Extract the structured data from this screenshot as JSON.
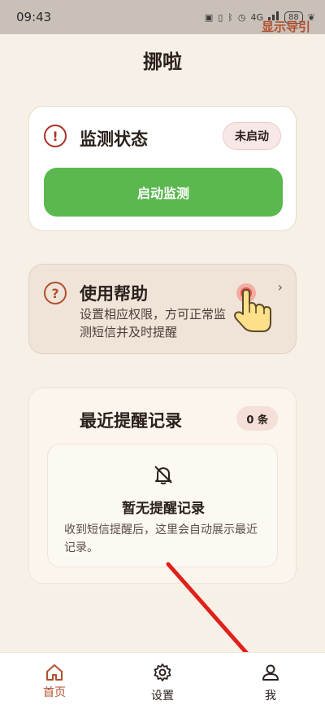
{
  "status_bar": {
    "time": "09:43",
    "network_label": "4G",
    "battery": "88"
  },
  "header": {
    "title": "挪啦",
    "guide_link": "显示导引"
  },
  "monitor_card": {
    "title": "监测状态",
    "badge": "未启动",
    "button_label": "启动监测"
  },
  "help_card": {
    "title": "使用帮助",
    "description": "设置相应权限，方可正常监测短信并及时提醒",
    "chevron": "›"
  },
  "records_card": {
    "title": "最近提醒记录",
    "count_badge": "0 条",
    "empty_title": "暂无提醒记录",
    "empty_description": "收到短信提醒后，这里会自动展示最近记录。"
  },
  "bottom_nav": {
    "items": [
      {
        "label": "首页",
        "icon": "home-icon",
        "active": true
      },
      {
        "label": "设置",
        "icon": "gear-icon",
        "active": false
      },
      {
        "label": "我",
        "icon": "person-icon",
        "active": false
      }
    ]
  },
  "colors": {
    "accent": "#B0502F",
    "primary_button": "#5BB84F",
    "alert": "#A93226",
    "background": "#F7F0E6",
    "annotation_arrow": "#E0201B"
  }
}
